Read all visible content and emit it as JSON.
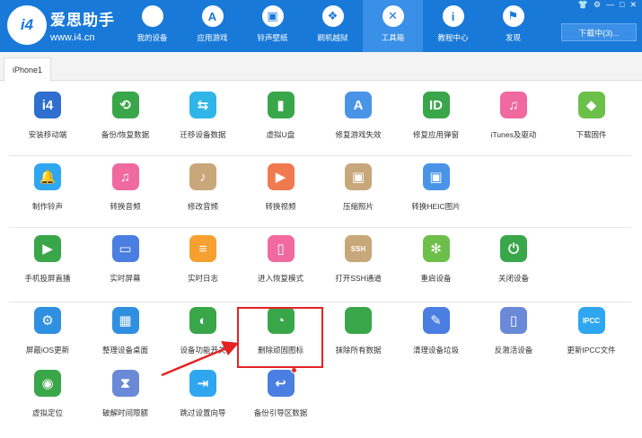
{
  "app": {
    "logo_text": "i4",
    "brand_name": "爱思助手",
    "brand_url": "www.i4.cn",
    "download_label": "下载中(3)..."
  },
  "nav": [
    {
      "label": "我的设备",
      "icon": "apple-icon"
    },
    {
      "label": "应用游戏",
      "icon": "appstore-icon"
    },
    {
      "label": "铃声壁纸",
      "icon": "wallpaper-icon"
    },
    {
      "label": "刷机越狱",
      "icon": "dropbox-icon"
    },
    {
      "label": "工具箱",
      "icon": "toolbox-icon"
    },
    {
      "label": "教程中心",
      "icon": "info-icon"
    },
    {
      "label": "发现",
      "icon": "flag-icon"
    }
  ],
  "active_nav": "工具箱",
  "device_tab": "iPhone1",
  "tools": [
    [
      {
        "label": "安装移动端",
        "color": "#2e6fcf",
        "glyph": "i4"
      },
      {
        "label": "备份/恢复数据",
        "color": "#3aa64a",
        "glyph": "⟲"
      },
      {
        "label": "迁移设备数据",
        "color": "#2fb5e8",
        "glyph": "⇆"
      },
      {
        "label": "虚拟U盘",
        "color": "#3aa64a",
        "glyph": "▮"
      },
      {
        "label": "修复游戏失效",
        "color": "#4a94e8",
        "glyph": "A"
      },
      {
        "label": "修复应用弹窗",
        "color": "#3aa64a",
        "glyph": "ID"
      },
      {
        "label": "iTunes及驱动",
        "color": "#f06aa0",
        "glyph": "♫"
      },
      {
        "label": "下载固件",
        "color": "#6cc04a",
        "glyph": "◆"
      }
    ],
    [
      {
        "label": "制作铃声",
        "color": "#2fa6f0",
        "glyph": "🔔"
      },
      {
        "label": "转换音频",
        "color": "#f06aa0",
        "glyph": "♫"
      },
      {
        "label": "修改音频",
        "color": "#c8a77a",
        "glyph": "♪"
      },
      {
        "label": "转换视频",
        "color": "#f07a50",
        "glyph": "▶"
      },
      {
        "label": "压缩照片",
        "color": "#c8a77a",
        "glyph": "▣"
      },
      {
        "label": "转换HEIC图片",
        "color": "#4a94e8",
        "glyph": "▣"
      }
    ],
    [
      {
        "label": "手机投屏直播",
        "color": "#3aa64a",
        "glyph": "▶"
      },
      {
        "label": "实时屏幕",
        "color": "#4a7ee0",
        "glyph": "▭"
      },
      {
        "label": "实时日志",
        "color": "#f5a030",
        "glyph": "≡"
      },
      {
        "label": "进入恢复模式",
        "color": "#f06aa0",
        "glyph": "▯"
      },
      {
        "label": "打开SSH通道",
        "color": "#c8a77a",
        "glyph": "SSH"
      },
      {
        "label": "重启设备",
        "color": "#6cc04a",
        "glyph": "✻"
      },
      {
        "label": "关闭设备",
        "color": "#3aa64a",
        "glyph": "⏻"
      }
    ],
    [
      {
        "label": "屏蔽iOS更新",
        "color": "#2f8fe0",
        "glyph": "⚙"
      },
      {
        "label": "整理设备桌面",
        "color": "#2f8fe0",
        "glyph": "▦"
      },
      {
        "label": "设备功能开关",
        "color": "#3aa64a",
        "glyph": "◐"
      },
      {
        "label": "删除顽固图标",
        "color": "#3aa64a",
        "glyph": "◔"
      },
      {
        "label": "抹除所有数据",
        "color": "#3aa64a",
        "glyph": ""
      },
      {
        "label": "清理设备垃圾",
        "color": "#4a7ee0",
        "glyph": "✎"
      },
      {
        "label": "反激活设备",
        "color": "#6a8ad8",
        "glyph": "▯"
      },
      {
        "label": "更新IPCC文件",
        "color": "#2fa6f0",
        "glyph": "IPCC"
      }
    ],
    [
      {
        "label": "虚拟定位",
        "color": "#3aa64a",
        "glyph": "◉"
      },
      {
        "label": "破解时间限额",
        "color": "#6a8ad8",
        "glyph": "⧗"
      },
      {
        "label": "跳过设置向导",
        "color": "#2fa6f0",
        "glyph": "⇥"
      },
      {
        "label": "备份引导区数据",
        "color": "#4a7ee0",
        "glyph": "↩",
        "badge": true
      }
    ]
  ],
  "highlighted_tool": "删除顽固图标"
}
